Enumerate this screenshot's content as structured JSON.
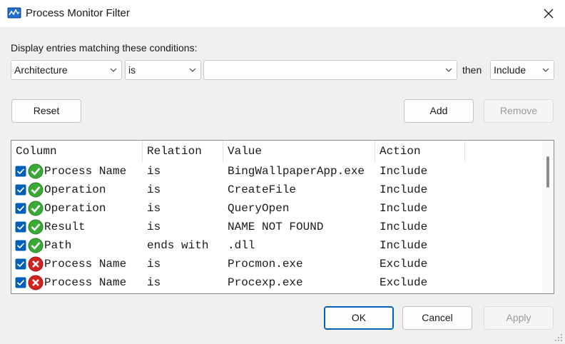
{
  "window": {
    "title": "Process Monitor Filter",
    "close_icon": "close-icon"
  },
  "conditions": {
    "label": "Display entries matching these conditions:",
    "column_select": "Architecture",
    "relation_select": "is",
    "value_input": "",
    "then_label": "then",
    "action_select": "Include"
  },
  "buttons": {
    "reset": "Reset",
    "add": "Add",
    "remove": "Remove",
    "ok": "OK",
    "cancel": "Cancel",
    "apply": "Apply"
  },
  "table": {
    "headers": {
      "column": "Column",
      "relation": "Relation",
      "value": "Value",
      "action": "Action"
    },
    "rows": [
      {
        "column": "Process Name",
        "relation": "is",
        "value": "BingWallpaperApp.exe",
        "action": "Include",
        "status": "include"
      },
      {
        "column": "Operation",
        "relation": "is",
        "value": "CreateFile",
        "action": "Include",
        "status": "include"
      },
      {
        "column": "Operation",
        "relation": "is",
        "value": "QueryOpen",
        "action": "Include",
        "status": "include"
      },
      {
        "column": "Result",
        "relation": "is",
        "value": "NAME NOT FOUND",
        "action": "Include",
        "status": "include"
      },
      {
        "column": "Path",
        "relation": "ends with",
        "value": ".dll",
        "action": "Include",
        "status": "include"
      },
      {
        "column": "Process Name",
        "relation": "is",
        "value": "Procmon.exe",
        "action": "Exclude",
        "status": "exclude"
      },
      {
        "column": "Process Name",
        "relation": "is",
        "value": "Procexp.exe",
        "action": "Exclude",
        "status": "exclude"
      }
    ]
  },
  "colors": {
    "accent": "#005fb8",
    "include": "#3aa935",
    "exclude": "#d32020"
  }
}
